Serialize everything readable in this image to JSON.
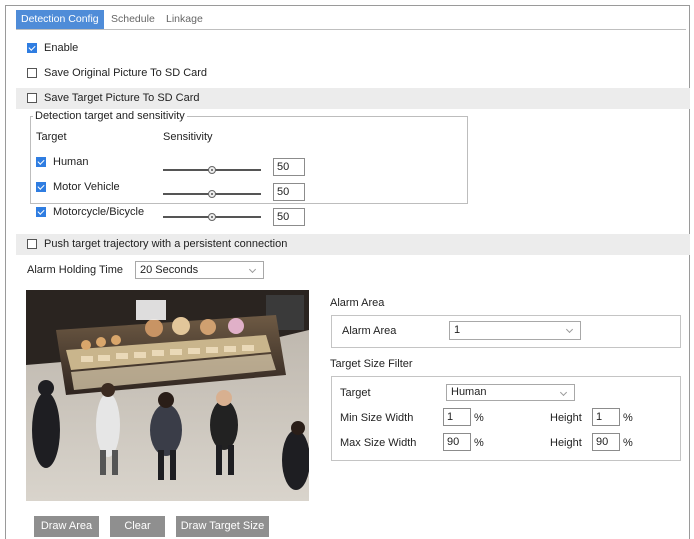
{
  "tabs": [
    {
      "label": "Detection Config",
      "active": true
    },
    {
      "label": "Schedule",
      "active": false
    },
    {
      "label": "Linkage",
      "active": false
    }
  ],
  "options": {
    "enable": {
      "label": "Enable",
      "checked": true
    },
    "save_original": {
      "label": "Save Original Picture To SD Card",
      "checked": false
    },
    "save_target": {
      "label": "Save Target Picture To SD Card",
      "checked": false
    },
    "push_trajectory": {
      "label": "Push target trajectory with a persistent connection",
      "checked": false
    }
  },
  "detection": {
    "legend": "Detection target and sensitivity",
    "col_target": "Target",
    "col_sensitivity": "Sensitivity",
    "targets": [
      {
        "label": "Human",
        "checked": true,
        "sensitivity": "50",
        "level": 0.5
      },
      {
        "label": "Motor Vehicle",
        "checked": true,
        "sensitivity": "50",
        "level": 0.5
      },
      {
        "label": "Motorcycle/Bicycle",
        "checked": true,
        "sensitivity": "50",
        "level": 0.5
      }
    ]
  },
  "alarm_holding": {
    "label": "Alarm Holding Time",
    "value": "20 Seconds"
  },
  "alarm_area": {
    "title": "Alarm Area",
    "field_label": "Alarm Area",
    "value": "1"
  },
  "target_size_filter": {
    "title": "Target Size Filter",
    "target_label": "Target",
    "target_value": "Human",
    "min_width_label": "Min Size Width",
    "min_width": "1",
    "min_height_label": "Height",
    "min_height": "1",
    "max_width_label": "Max Size Width",
    "max_width": "90",
    "max_height_label": "Height",
    "max_height": "90",
    "unit": "%"
  },
  "buttons": {
    "draw_area": "Draw Area",
    "clear": "Clear",
    "draw_target_size": "Draw Target Size"
  },
  "colors": {
    "accent": "#4f8cd8",
    "checkbox": "#2f7de1",
    "button": "#8f8f8f",
    "band": "#ececec"
  }
}
